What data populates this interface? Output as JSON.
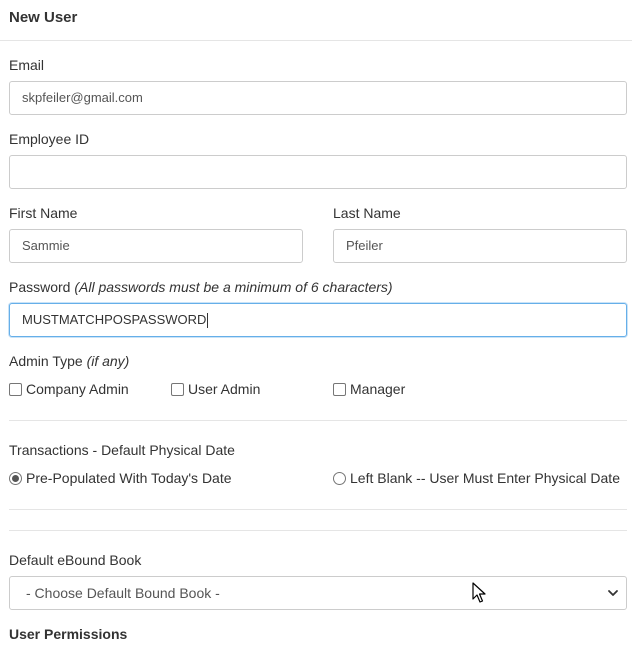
{
  "header": {
    "title": "New User"
  },
  "email": {
    "label": "Email",
    "value": "skpfeiler@gmail.com"
  },
  "employee_id": {
    "label": "Employee ID",
    "value": ""
  },
  "first_name": {
    "label": "First Name",
    "value": "Sammie"
  },
  "last_name": {
    "label": "Last Name",
    "value": "Pfeiler"
  },
  "password": {
    "label": "Password",
    "hint": "(All passwords must be a minimum of 6 characters)",
    "value": "MUSTMATCHPOSPASSWORD"
  },
  "admin_type": {
    "label": "Admin Type",
    "hint": "(if any)",
    "options": [
      {
        "label": "Company Admin",
        "checked": false
      },
      {
        "label": "User Admin",
        "checked": false
      },
      {
        "label": "Manager",
        "checked": false
      }
    ]
  },
  "transactions": {
    "label": "Transactions - Default Physical Date",
    "options": [
      {
        "label": "Pre-Populated With Today's Date",
        "checked": true
      },
      {
        "label": "Left Blank -- User Must Enter Physical Date",
        "checked": false
      }
    ]
  },
  "default_bound_book": {
    "label": "Default eBound Book",
    "selected": "- Choose Default Bound Book -"
  },
  "permissions": {
    "title": "User Permissions"
  },
  "colors": {
    "focus_border": "#66afe9",
    "border": "#cccccc",
    "text": "#333333"
  }
}
